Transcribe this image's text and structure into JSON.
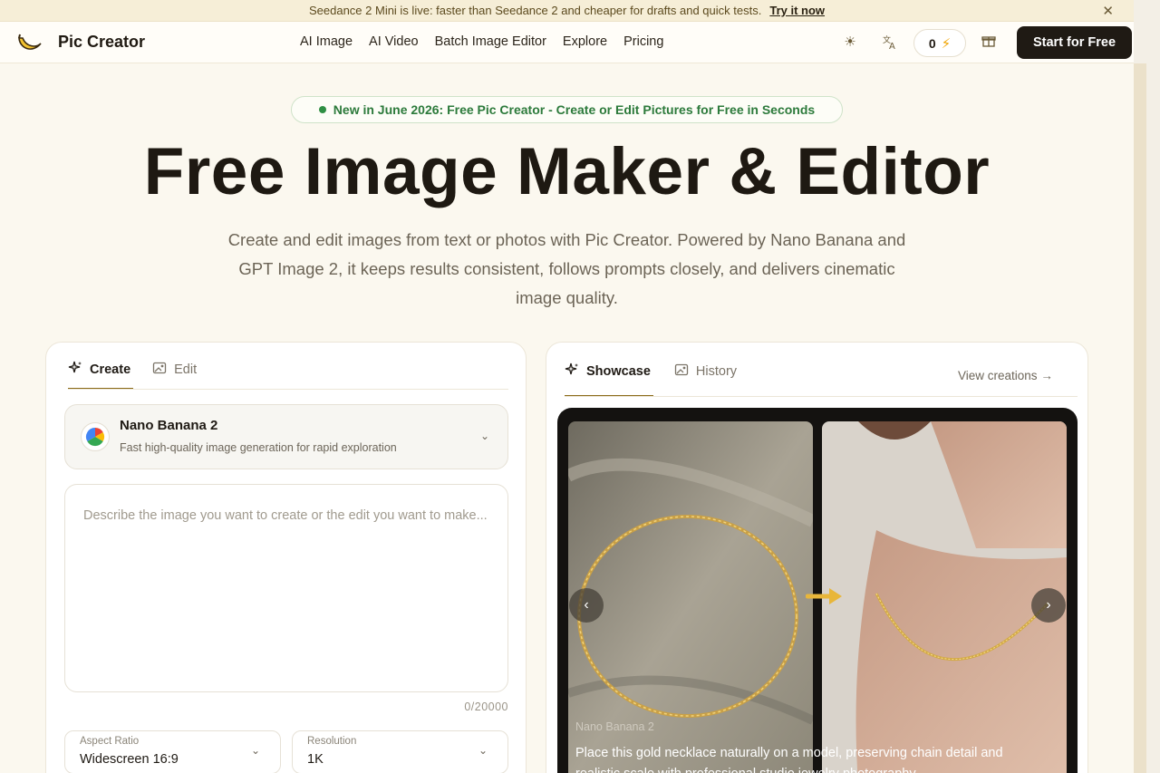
{
  "announcement": {
    "text": "Seedance 2 Mini is live: faster than Seedance 2 and cheaper for drafts and quick tests.",
    "cta": "Try it now",
    "close_icon": "close-icon"
  },
  "nav": {
    "brand": "Pic Creator",
    "links": [
      "AI Image",
      "AI Video",
      "Batch Image Editor",
      "Explore",
      "Pricing"
    ],
    "theme_icon": "sun-icon",
    "language_icon": "translate-icon",
    "credits": "0",
    "credits_icon": "bolt-icon",
    "gift_icon": "gift-icon",
    "start_button": "Start for Free"
  },
  "hero": {
    "badge": "New in June 2026: Free Pic Creator - Create or Edit Pictures for Free in Seconds",
    "title": "Free Image Maker & Editor",
    "subtitle": "Create and edit images from text or photos with Pic Creator. Powered by Nano Banana and GPT Image 2, it keeps results consistent, follows prompts closely, and delivers cinematic image quality."
  },
  "creator": {
    "tabs": [
      {
        "label": "Create",
        "icon": "sparkle-icon",
        "active": true
      },
      {
        "label": "Edit",
        "icon": "image-edit-icon",
        "active": false
      }
    ],
    "model": {
      "name": "Nano Banana 2",
      "description": "Fast high-quality image generation for rapid exploration"
    },
    "prompt": {
      "placeholder": "Describe the image you want to create or the edit you want to make...",
      "value": ""
    },
    "counter": "0/20000",
    "aspect_ratio": {
      "label": "Aspect Ratio",
      "value": "Widescreen 16:9"
    },
    "resolution": {
      "label": "Resolution",
      "value": "1K"
    }
  },
  "showcase": {
    "tabs": [
      {
        "label": "Showcase",
        "icon": "sparkle-icon",
        "active": true
      },
      {
        "label": "History",
        "icon": "image-icon",
        "active": false
      }
    ],
    "view_link": "View creations",
    "item": {
      "model": "Nano Banana 2",
      "caption": "Place this gold necklace naturally on a model, preserving chain detail and realistic scale with professional studio jewelry photography."
    }
  },
  "colors": {
    "accent": "#8a6a18",
    "dark_button": "#1f1a14",
    "badge_green": "#2c7a3b",
    "credits_bolt": "#f0a400"
  }
}
